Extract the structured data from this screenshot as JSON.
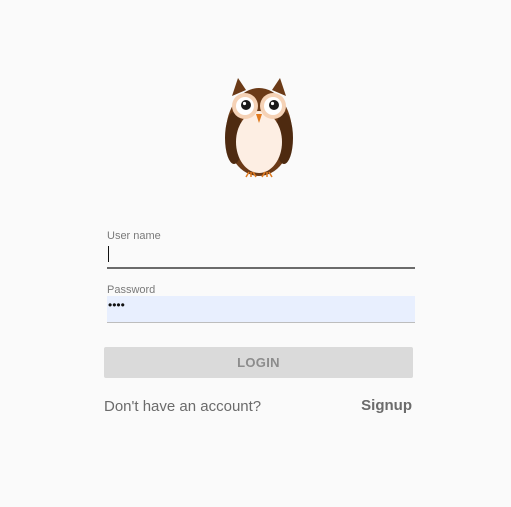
{
  "logo": {
    "icon": "owl-icon"
  },
  "form": {
    "username": {
      "label": "User name",
      "value": ""
    },
    "password": {
      "label": "Password",
      "value": "••••"
    },
    "login_label": "LOGIN"
  },
  "footer": {
    "prompt": "Don't have an account?",
    "signup_label": "Signup"
  },
  "colors": {
    "background": "#fafafa",
    "autofill": "#e8effe",
    "button_disabled": "#dadada",
    "owl_body": "#6b3a17",
    "owl_belly": "#fdeee3"
  }
}
